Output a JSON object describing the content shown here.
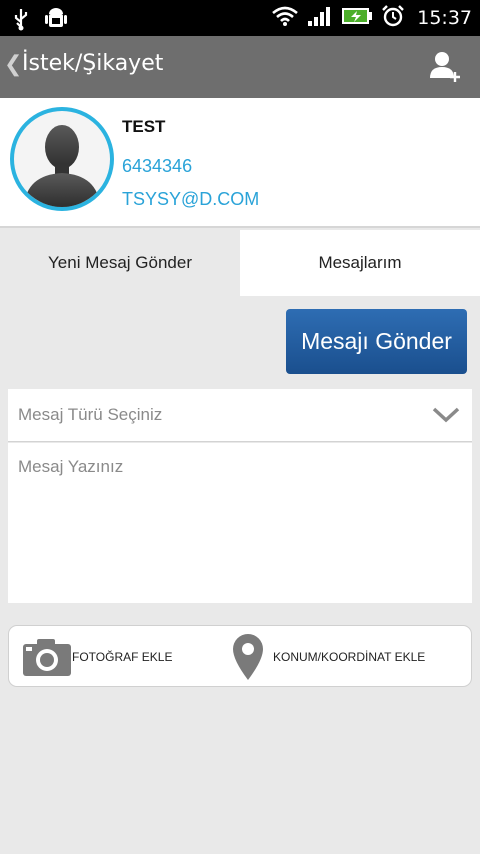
{
  "status_bar": {
    "time": "15:37",
    "icons": [
      "usb-icon",
      "android-debug-icon",
      "wifi-icon",
      "signal-icon",
      "battery-charging-icon",
      "alarm-icon"
    ]
  },
  "action_bar": {
    "back_glyph": "❮",
    "title": "İstek/Şikayet",
    "add_user_icon": "add-user-icon"
  },
  "profile": {
    "name": "TEST",
    "phone": "6434346",
    "email": "TSYSY@D.COM",
    "avatar_icon": "default-avatar-icon"
  },
  "tabs": [
    {
      "label": "Yeni Mesaj Gönder",
      "selected": true
    },
    {
      "label": "Mesajlarım",
      "selected": false
    }
  ],
  "form": {
    "send_button_label": "Mesajı Gönder",
    "type_select_placeholder": "Mesaj Türü Seçiniz",
    "message_placeholder": "Mesaj Yazınız"
  },
  "attachments": {
    "photo_label": "FOTOĞRAF EKLE",
    "location_label": "KONUM/KOORDİNAT EKLE"
  },
  "colors": {
    "action_bar": "#6e6e6e",
    "accent_blue": "#2aa3d8",
    "avatar_ring": "#2bb3e0",
    "send_button": "#1f5a9c",
    "background": "#e9e9e9"
  }
}
